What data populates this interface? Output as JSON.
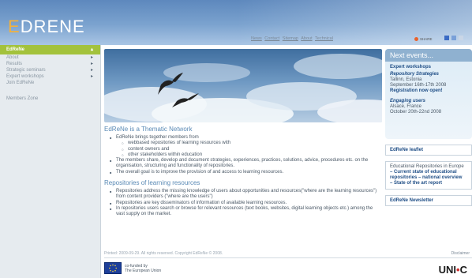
{
  "header": {
    "logo_first": "E",
    "logo_rest": "DRENE"
  },
  "topnav": [
    "News",
    "Contact",
    "Sitemap",
    "About",
    "Technical"
  ],
  "share": {
    "label": "SHARE"
  },
  "sidebar": {
    "active": "EdReNe",
    "items": [
      {
        "label": "About",
        "arrow": "▸"
      },
      {
        "label": "Results",
        "arrow": "▸"
      },
      {
        "label": "Strategic seminars",
        "arrow": "▸"
      },
      {
        "label": "Expert workshops",
        "arrow": "▸"
      },
      {
        "label": "Join EdReNe",
        "arrow": ""
      }
    ],
    "members_zone": "Members Zone"
  },
  "main": {
    "section1_title": "EdReNe is a Thematic Network",
    "section1_bullets": [
      "EdReNe brings together members from",
      "The members share, develop and document strategies, experiences, practices, solutions, advice, procedures etc. on the organisation, structuring and functionality of repositories.",
      "The overall goal is to improve the provision of and access to learning resources."
    ],
    "section1_sub": [
      "webbased repositories of learning resources with",
      "content owners and",
      "other stakeholders within education"
    ],
    "section2_title": "Repositories of learning resources",
    "section2_bullets": [
      "Repositories address the missing knowledge of users about opportunities and resources(\"where are the learning resources\") from content providers (\"where are the users\")",
      "Repositories are key disseminators of information of available learning resources.",
      "In repositories users search or browse for relevant resources (text books, websites, digital learning objects etc.) among the vast supply on the market."
    ]
  },
  "footer": {
    "printed": "Printed: 2009-09-29. All rights reserved. Copyright EdReNe © 2008.",
    "disclaimer": "Disclaimer",
    "eu_line1": "co-funded by",
    "eu_line2": "The European Union",
    "unic_a": "UNI",
    "unic_dot": "•",
    "unic_b": "C"
  },
  "right": {
    "events_title": "Next events...",
    "events_head": "Expert workshops",
    "ev1_name": "Repository Strategies",
    "ev1_place": "Tallinn, Estonia",
    "ev1_date": "September 16th-17th 2008",
    "ev1_link": "Registration now open!",
    "ev2_name": "Engaging users",
    "ev2_place": "Alsace, France",
    "ev2_date": "October 20th-22nd 2008",
    "leaflet": "EdReNe leaflet",
    "box2_text": "Educational Repositories in Europe",
    "box2_link1": "– Current state of educational repositories – national overview",
    "box2_link2": "– State of the art report",
    "newsletter": "EdReNe Newsletter"
  },
  "colors": {
    "header": "#6e97c7",
    "logo_accent": "#f2b13d",
    "sidebar_active": "#a3c23c",
    "link": "#1f4e86",
    "section_title": "#5a8ab5"
  }
}
